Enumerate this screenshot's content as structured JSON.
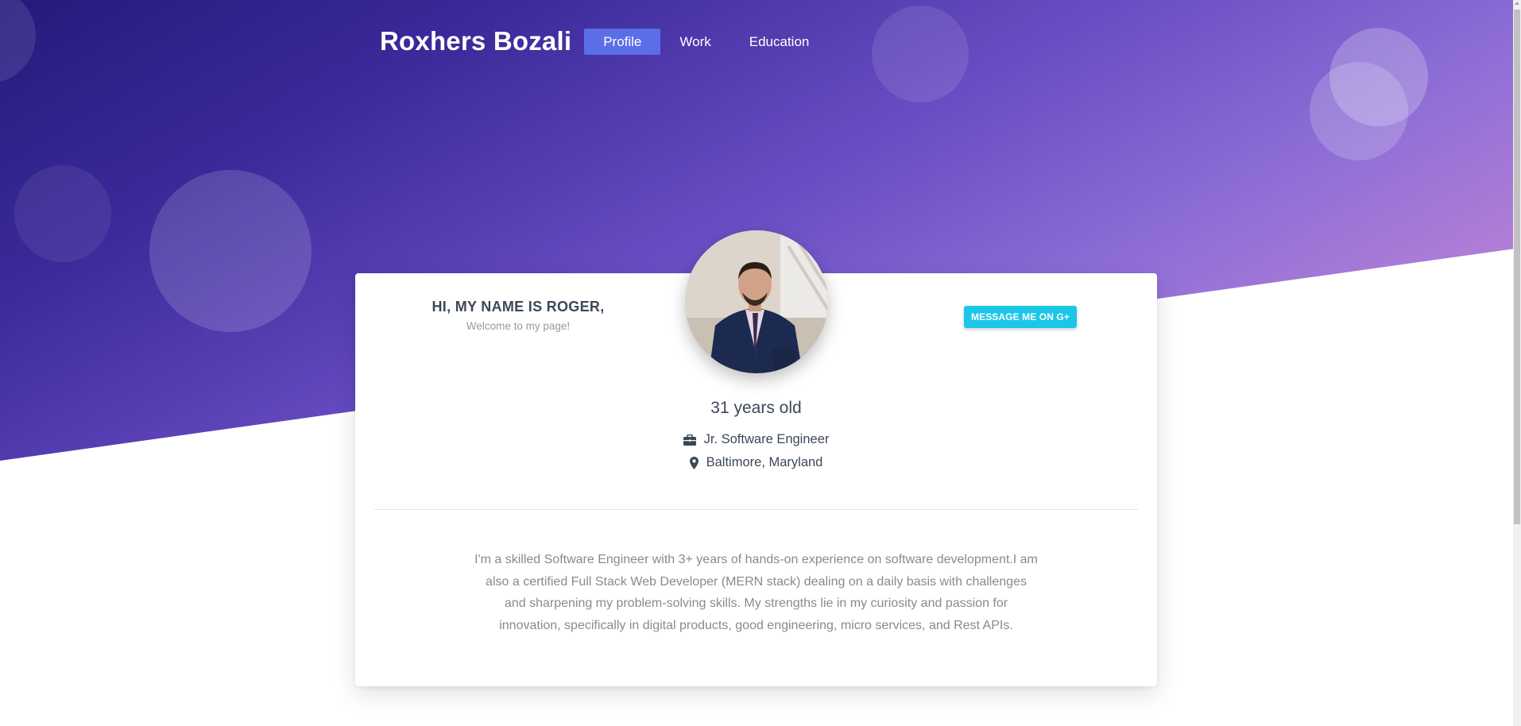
{
  "nav": {
    "brand": "Roxhers Bozali",
    "links": [
      {
        "label": "Profile",
        "active": true
      },
      {
        "label": "Work",
        "active": false
      },
      {
        "label": "Education",
        "active": false
      }
    ]
  },
  "profile": {
    "greeting_title": "HI, MY NAME IS ROGER,",
    "greeting_sub": "Welcome to my page!",
    "message_button": "MESSAGE ME ON G+",
    "age": "31 years old",
    "job_title": "Jr. Software Engineer",
    "location": "Baltimore, Maryland",
    "bio": "I'm a skilled Software Engineer with 3+ years of hands-on experience on software development.I am also a certified Full Stack Web Developer (MERN stack) dealing on a daily basis with challenges and sharpening my problem-solving skills. My strengths lie in my curiosity and passion for innovation, specifically in digital products, good engineering, micro services, and Rest APIs."
  },
  "icons": {
    "briefcase": "briefcase-icon",
    "location": "map-pin-icon",
    "googleplus": "google-plus-icon"
  },
  "colors": {
    "nav_active": "#5b6ee8",
    "message_button": "#1cc6e8",
    "heading_text": "#3c4858"
  }
}
